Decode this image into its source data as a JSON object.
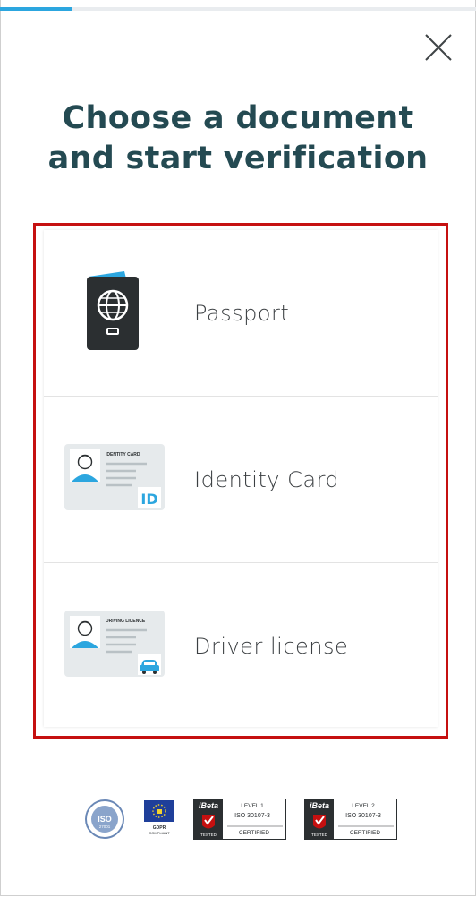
{
  "progress": {
    "fraction": 0.15,
    "color": "#2ca6df"
  },
  "header": {
    "close_icon": "close-icon"
  },
  "title": {
    "line1": "Choose a document",
    "line2": "and start verification"
  },
  "documents": [
    {
      "label": "Passport",
      "icon": "passport-icon"
    },
    {
      "label": "Identity Card",
      "icon": "identity-card-icon"
    },
    {
      "label": "Driver license",
      "icon": "driver-license-icon"
    }
  ],
  "icon_text": {
    "id_card_header": "IDENTITY CARD",
    "id_card_badge": "ID",
    "driving_header": "DRIVING LICENCE"
  },
  "certifications": {
    "iso": {
      "label": "ISO",
      "number": "27001"
    },
    "gdpr": {
      "line1": "GDPR",
      "line2": "COMPLIANT"
    },
    "ibeta1": {
      "brand": "iBeta",
      "level": "LEVEL 1",
      "standard": "ISO 30107-3",
      "status": "CERTIFIED",
      "tested": "TESTED"
    },
    "ibeta2": {
      "brand": "iBeta",
      "level": "LEVEL 2",
      "standard": "ISO 30107-3",
      "status": "CERTIFIED",
      "tested": "TESTED"
    }
  },
  "colors": {
    "title": "#244a52",
    "highlight": "#c51010",
    "accent": "#2ca6df"
  }
}
